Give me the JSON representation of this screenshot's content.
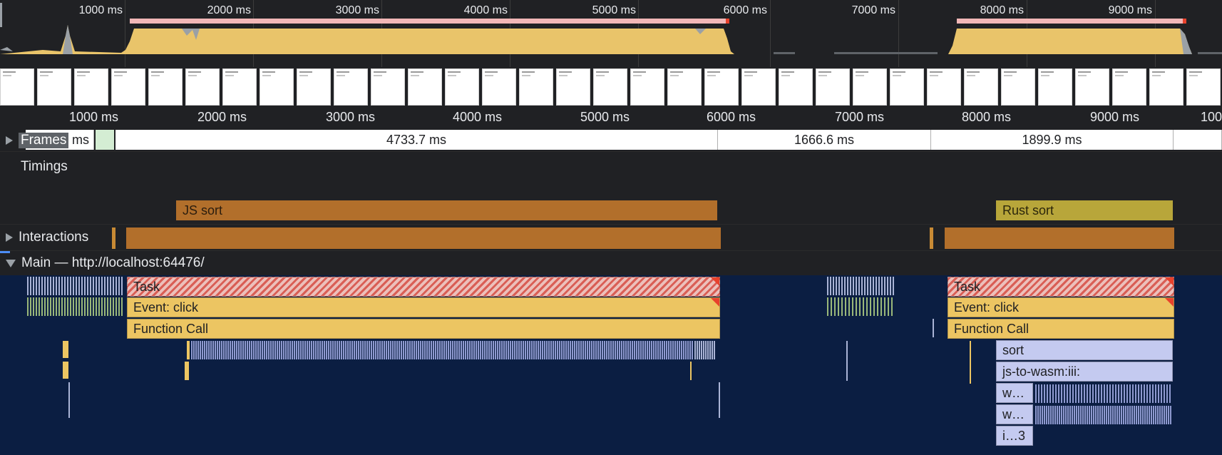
{
  "overview": {
    "tick_labels": [
      "1000 ms",
      "2000 ms",
      "3000 ms",
      "4000 ms",
      "5000 ms",
      "6000 ms",
      "7000 ms",
      "8000 ms",
      "9000 ms"
    ]
  },
  "ruler": {
    "tick_labels": [
      "1000 ms",
      "2000 ms",
      "3000 ms",
      "4000 ms",
      "5000 ms",
      "6000 ms",
      "7000 ms",
      "8000 ms",
      "9000 ms",
      "100"
    ]
  },
  "tracks": {
    "frames": {
      "label": "Frames",
      "segments": [
        "ms",
        "4733.7 ms",
        "1666.6 ms",
        "1899.9 ms"
      ]
    },
    "timings": {
      "label": "Timings",
      "bars": [
        {
          "label": "JS sort",
          "color": "#b26f2b",
          "text_color": "#2b1d0e"
        },
        {
          "label": "Rust sort",
          "color": "#b8a63a",
          "text_color": "#2b260b"
        }
      ]
    },
    "interactions": {
      "label": "Interactions",
      "color": "#b26f2b"
    },
    "main": {
      "label": "Main — http://localhost:64476/",
      "accent_color": "#4c8df6",
      "background": "#0b1e42",
      "flame_left": [
        {
          "name": "Task"
        },
        {
          "name": "Event: click"
        },
        {
          "name": "Function Call"
        }
      ],
      "flame_right": [
        {
          "name": "Task"
        },
        {
          "name": "Event: click"
        },
        {
          "name": "Function Call"
        },
        {
          "name": "sort"
        },
        {
          "name": "js-to-wasm:iii:"
        },
        {
          "name": "w…"
        },
        {
          "name": "w…"
        },
        {
          "name": "i…3"
        }
      ]
    }
  },
  "colors": {
    "cpu_fill": "#e9c46a",
    "range_bar": "#f2b7b7",
    "range_end": "#e8412c",
    "task_stripe": "#d95e55",
    "event_yellow": "#ecc562",
    "wasm_lavender": "#c4caf0"
  }
}
